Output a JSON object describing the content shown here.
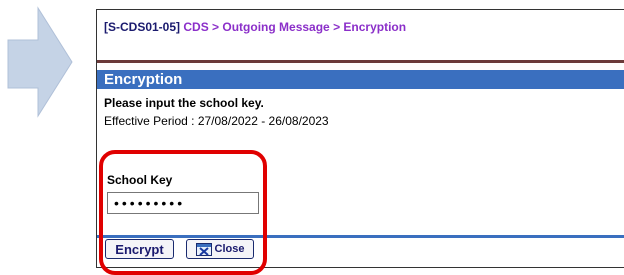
{
  "breadcrumb": {
    "code": "[S-CDS01-05]",
    "path": "CDS > Outgoing Message > Encryption"
  },
  "section": {
    "title": "Encryption"
  },
  "form": {
    "instruction": "Please input the school key.",
    "effective_period": "Effective Period : 27/08/2022 - 26/08/2023",
    "key_label": "School Key",
    "key_value": "•••••••••"
  },
  "buttons": {
    "encrypt_label": "Encrypt",
    "close_label": "Close"
  },
  "icons": {
    "arrow": "right-arrow-icon",
    "close": "close-window-icon"
  },
  "colors": {
    "header_bar": "#3a6fbf",
    "breadcrumb_path": "#8b2fc9",
    "highlight": "#e00000"
  }
}
